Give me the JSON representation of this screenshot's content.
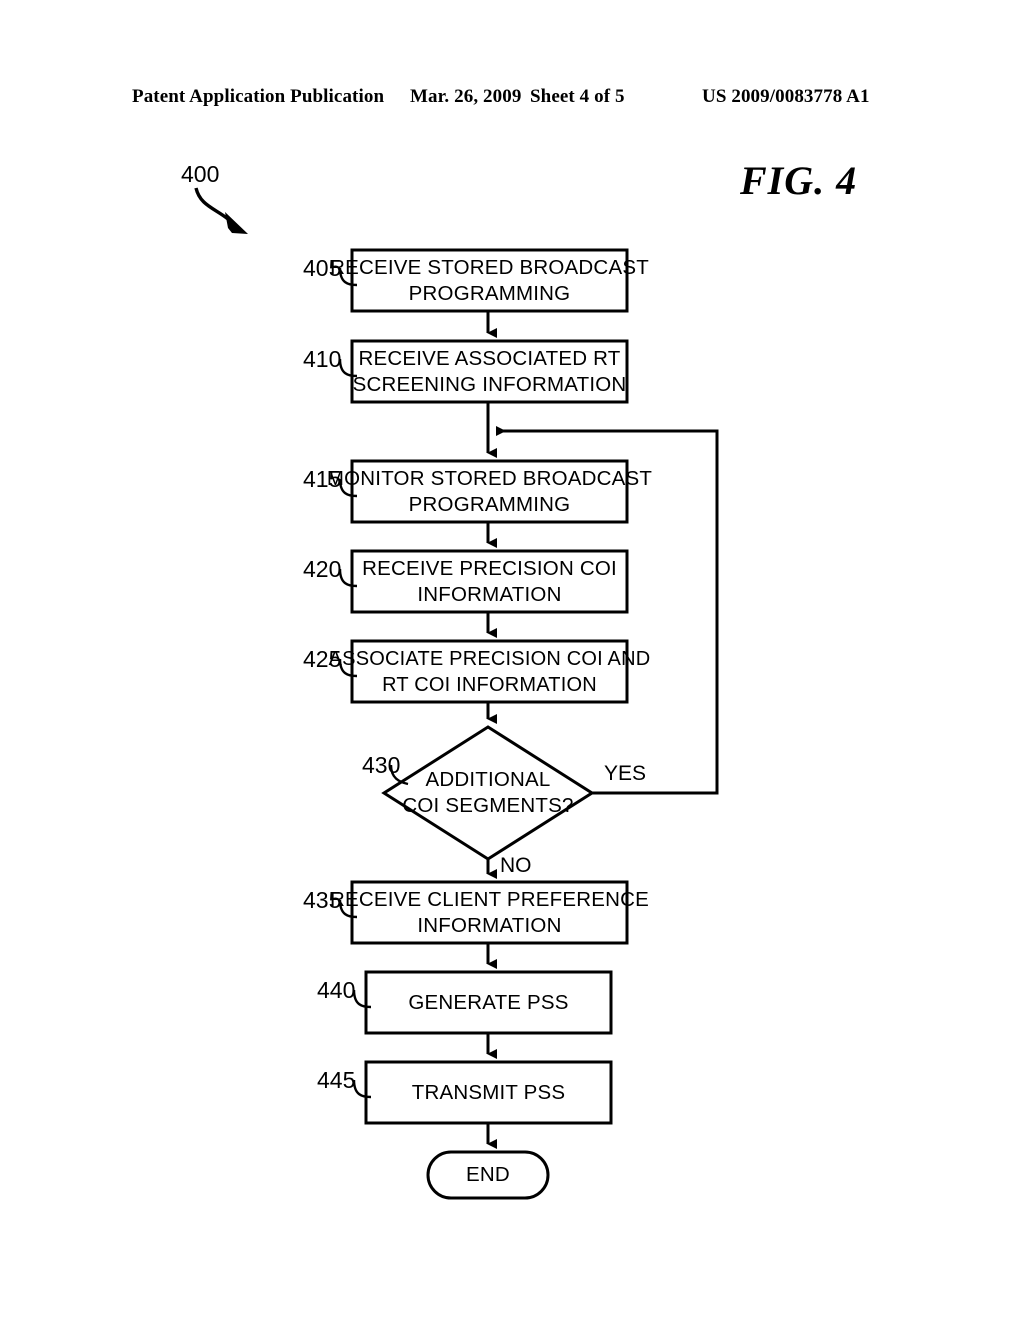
{
  "header": {
    "publication": "Patent Application Publication",
    "date": "Mar. 26, 2009",
    "sheet": "Sheet 4 of 5",
    "patent_number": "US 2009/0083778 A1"
  },
  "figure": {
    "label": "FIG. 4",
    "flow_reference": "400"
  },
  "nodes": [
    {
      "ref": "405",
      "type": "process",
      "lines": [
        "RECEIVE STORED BROADCAST",
        "PROGRAMMING"
      ]
    },
    {
      "ref": "410",
      "type": "process",
      "lines": [
        "RECEIVE ASSOCIATED RT",
        "SCREENING INFORMATION"
      ]
    },
    {
      "ref": "415",
      "type": "process",
      "lines": [
        "MONITOR STORED BROADCAST",
        "PROGRAMMING"
      ]
    },
    {
      "ref": "420",
      "type": "process",
      "lines": [
        "RECEIVE PRECISION COI",
        "INFORMATION"
      ]
    },
    {
      "ref": "425",
      "type": "process",
      "lines": [
        "ASSOCIATE PRECISION COI AND",
        "RT COI INFORMATION"
      ]
    },
    {
      "ref": "430",
      "type": "decision",
      "lines": [
        "ADDITIONAL",
        "COI SEGMENTS?"
      ]
    },
    {
      "ref": "435",
      "type": "process",
      "lines": [
        "RECEIVE CLIENT PREFERENCE",
        "INFORMATION"
      ]
    },
    {
      "ref": "440",
      "type": "process",
      "lines": [
        "GENERATE PSS"
      ]
    },
    {
      "ref": "445",
      "type": "process",
      "lines": [
        "TRANSMIT PSS"
      ]
    },
    {
      "ref": "",
      "type": "terminal",
      "lines": [
        "END"
      ]
    }
  ],
  "edge_labels": {
    "yes": "YES",
    "no": "NO"
  },
  "colors": {
    "ink": "#000000",
    "paper": "#ffffff"
  }
}
